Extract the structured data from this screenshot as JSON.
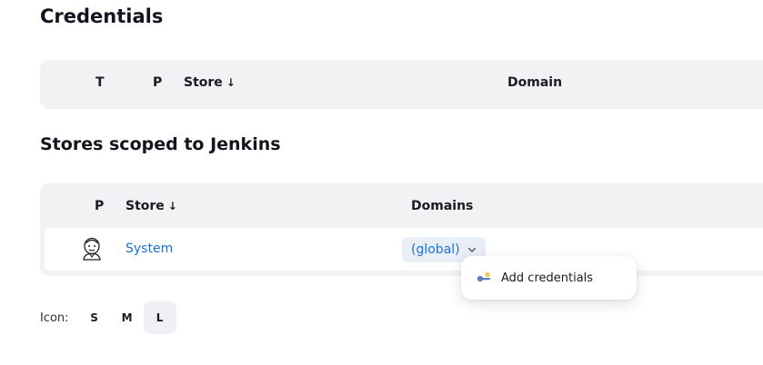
{
  "sections": {
    "credentials_title": "Credentials",
    "stores_title": "Stores scoped to Jenkins"
  },
  "credentials_table": {
    "headers": {
      "type": "T",
      "provider": "P",
      "store": "Store",
      "domain": "Domain"
    },
    "sort_arrow": "↓"
  },
  "stores_table": {
    "headers": {
      "provider": "P",
      "store": "Store",
      "domains": "Domains"
    },
    "sort_arrow": "↓",
    "rows": [
      {
        "icon": "jenkins-icon",
        "store": "System",
        "domain": "(global)"
      }
    ]
  },
  "dropdown": {
    "items": [
      {
        "icon": "key-icon",
        "label": "Add credentials"
      }
    ]
  },
  "icon_size": {
    "label": "Icon:",
    "options": [
      "S",
      "M",
      "L"
    ],
    "selected": "L"
  },
  "colors": {
    "link": "#1f6fcf",
    "table_bg": "#f2f2f5"
  }
}
